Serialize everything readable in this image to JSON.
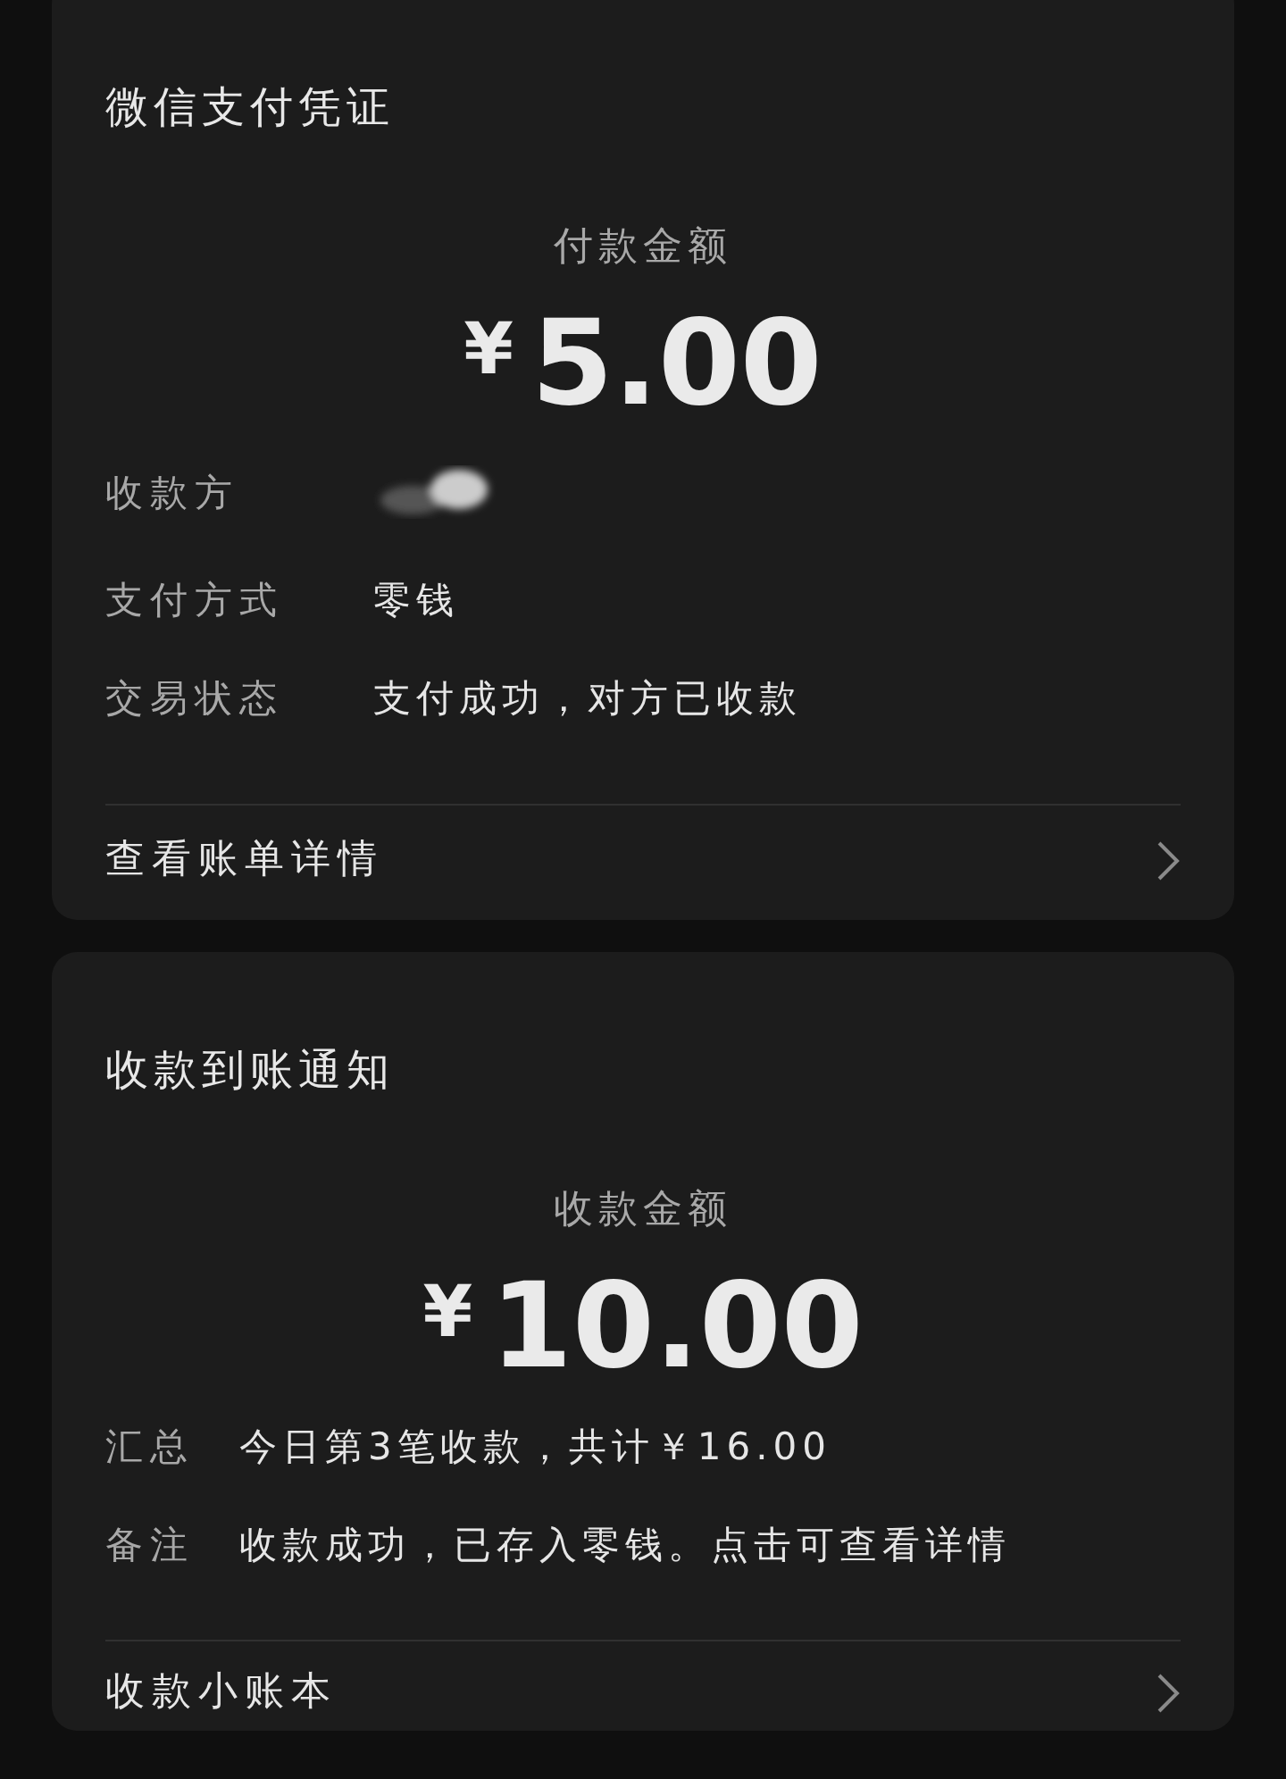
{
  "cards": [
    {
      "kind": "voucher",
      "title": "微信支付凭证",
      "amount_label": "付款金额",
      "currency": "¥",
      "amount": "5.00",
      "rows": [
        {
          "label": "收款方",
          "kind": "redacted"
        },
        {
          "label": "支付方式",
          "kind": "text",
          "value": "零钱"
        },
        {
          "label": "交易状态",
          "kind": "text",
          "value": "支付成功，对方已收款"
        }
      ],
      "link": "查看账单详情"
    },
    {
      "kind": "notice",
      "title": "收款到账通知",
      "amount_label": "收款金额",
      "currency": "¥",
      "amount": "10.00",
      "rows": [
        {
          "label": "汇总",
          "kind": "text",
          "value": "今日第3笔收款，共计￥16.00"
        },
        {
          "label": "备注",
          "kind": "text",
          "value": "收款成功，已存入零钱。点击可查看详情"
        }
      ],
      "link": "收款小账本"
    }
  ]
}
